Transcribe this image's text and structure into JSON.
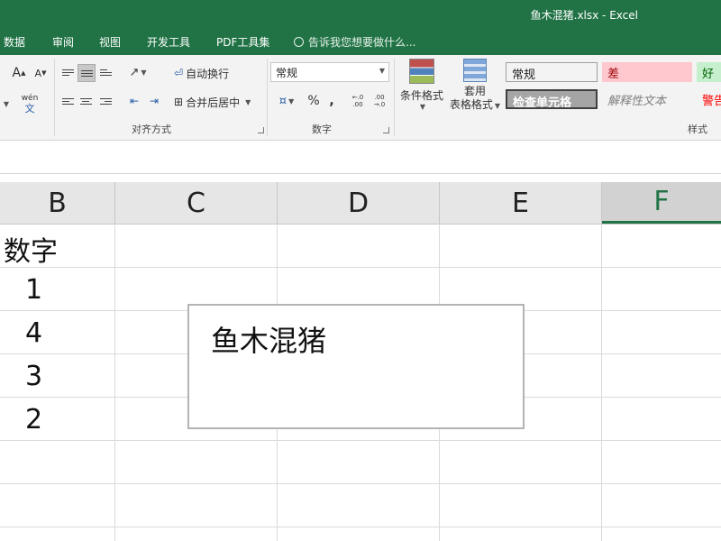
{
  "window": {
    "title": "鱼木混猪.xlsx - Excel"
  },
  "tabs": [
    {
      "label": "数据"
    },
    {
      "label": "审阅"
    },
    {
      "label": "视图"
    },
    {
      "label": "开发工具"
    },
    {
      "label": "PDF工具集"
    }
  ],
  "tell_me": {
    "placeholder": "告诉我您想要做什么..."
  },
  "ribbon": {
    "font_group": {
      "grow_label": "A",
      "shrink_label": "A",
      "phonetic_label": "wén",
      "phonetic_sub": "文"
    },
    "alignment": {
      "wrap_text": "自动换行",
      "merge_center": "合并后居中",
      "label": "对齐方式"
    },
    "number": {
      "format_value": "常规",
      "percent": "%",
      "comma": ",",
      "inc_decimal": "←.0 .00",
      "dec_decimal": ".00 →.0",
      "label": "数字"
    },
    "styles": {
      "conditional_format": "条件格式",
      "table_format_line1": "套用",
      "table_format_line2": "表格格式",
      "cells": [
        {
          "text": "常规",
          "fg": "#222222",
          "bg": "#ffffff"
        },
        {
          "text": "差",
          "fg": "#9c0006",
          "bg": "#ffc7ce"
        },
        {
          "text": "好",
          "fg": "#006100",
          "bg": "#c6efce"
        },
        {
          "text": "检查单元格",
          "fg": "#ffffff",
          "bg": "#a5a5a5"
        },
        {
          "text": "解释性文本",
          "fg": "#7f7f7f",
          "bg": "#f3f3f3"
        },
        {
          "text": "警告",
          "fg": "#ff0000",
          "bg": "#f3f3f3"
        }
      ],
      "label": "样式"
    }
  },
  "columns": [
    "B",
    "C",
    "D",
    "E",
    "F"
  ],
  "active_column": "F",
  "sheet": {
    "column_b": [
      "数字",
      "1",
      "4",
      "3",
      "2"
    ]
  },
  "textbox": {
    "text": "鱼木混猪"
  },
  "colors": {
    "excel_green": "#217346",
    "ribbon_bg": "#f3f3f3",
    "header_bg": "#e6e6e6"
  }
}
